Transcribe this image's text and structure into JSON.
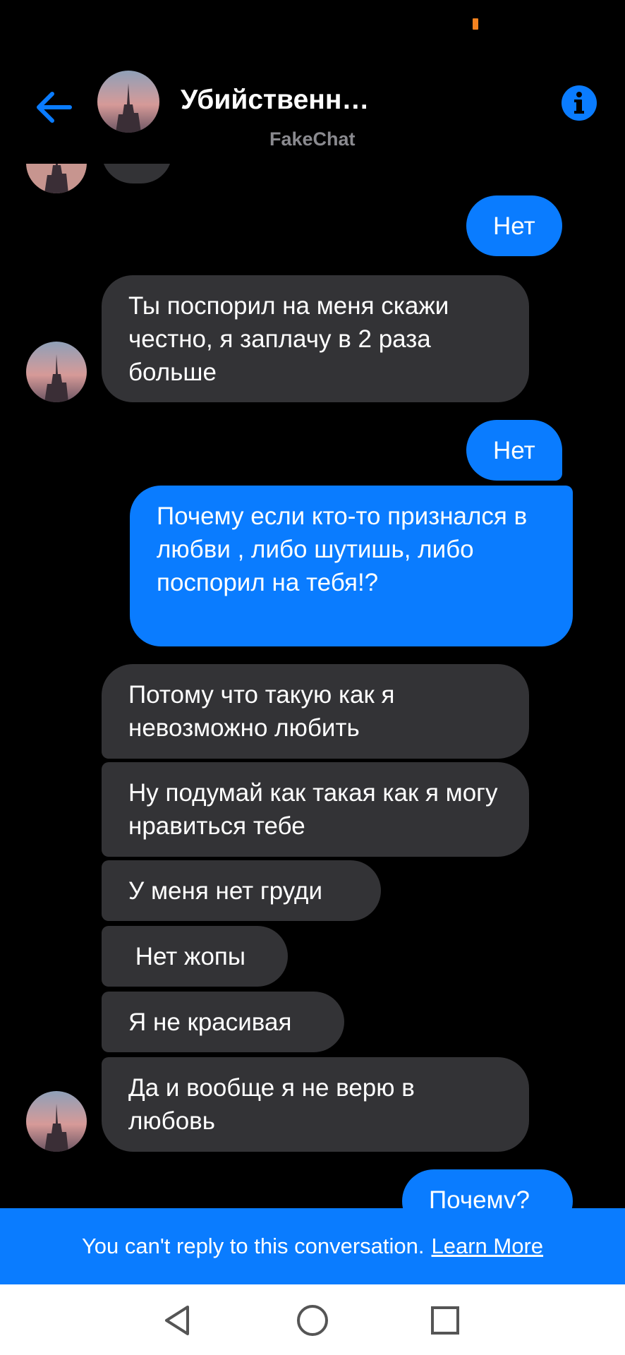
{
  "header": {
    "title": "Убийственн…",
    "subtitle": "FakeChat",
    "back_icon": "arrow-left-icon",
    "info_icon": "info-icon"
  },
  "messages": [
    {
      "side": "out",
      "text": "Нет"
    },
    {
      "side": "in",
      "text": "Ты поспорил на меня скажи честно, я заплачу в 2 раза больше"
    },
    {
      "side": "out",
      "text": "Нет"
    },
    {
      "side": "out",
      "text": "Почему если  кто-то признался в любви , либо шутишь, либо поспорил на тебя!?"
    },
    {
      "side": "in",
      "text": "Потому что такую как я невозможно любить"
    },
    {
      "side": "in",
      "text": "Ну подумай как такая  как я могу нравиться тебе"
    },
    {
      "side": "in",
      "text": "У меня нет груди"
    },
    {
      "side": "in",
      "text": " Нет жопы"
    },
    {
      "side": "in",
      "text": "Я не красивая"
    },
    {
      "side": "in",
      "text": "Да и вообще я не верю в любовь"
    },
    {
      "side": "out",
      "text": "Почему?"
    }
  ],
  "banner": {
    "text": "You can't reply to this conversation.",
    "link": "Learn More"
  },
  "navbar": {
    "back_icon": "nav-back-icon",
    "home_icon": "nav-home-icon",
    "recents_icon": "nav-recents-icon"
  },
  "colors": {
    "background": "#000000",
    "incoming_bubble": "#333336",
    "outgoing_bubble": "#0a7cff",
    "accent": "#0a7cff",
    "subtitle": "#8a8a8f"
  }
}
